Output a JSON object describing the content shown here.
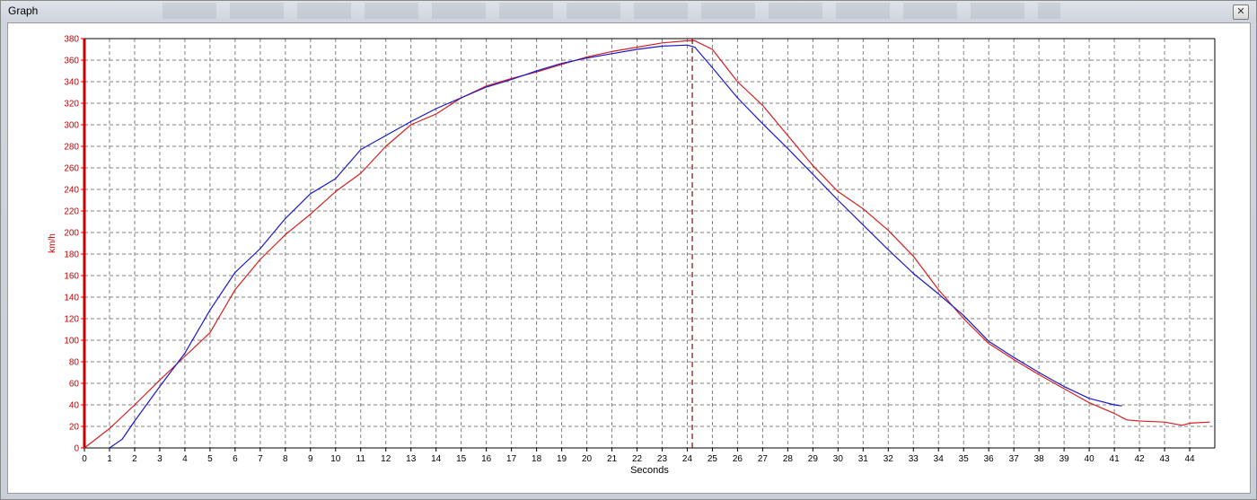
{
  "window": {
    "title": "Graph",
    "close_glyph": "✕",
    "close_icon": "close-icon"
  },
  "colors": {
    "axis": "#cc0000",
    "series_red": "#d42020",
    "series_blue": "#1a1acc",
    "marker": "#8b0000",
    "grid": "#808080"
  },
  "chart_data": {
    "type": "line",
    "xlabel": "Seconds",
    "ylabel": "km/h",
    "xlim": [
      0,
      45
    ],
    "ylim": [
      0,
      380
    ],
    "xticks": [
      0,
      1,
      2,
      3,
      4,
      5,
      6,
      7,
      8,
      9,
      10,
      11,
      12,
      13,
      14,
      15,
      16,
      17,
      18,
      19,
      20,
      21,
      22,
      23,
      24,
      25,
      26,
      27,
      28,
      29,
      30,
      31,
      32,
      33,
      34,
      35,
      36,
      37,
      38,
      39,
      40,
      41,
      42,
      43,
      44
    ],
    "yticks": [
      0,
      20,
      40,
      60,
      80,
      100,
      120,
      140,
      160,
      180,
      200,
      220,
      240,
      260,
      280,
      300,
      320,
      340,
      360,
      380
    ],
    "grid": true,
    "marker_x": 24.2,
    "series": [
      {
        "color": "red",
        "x": [
          0,
          1,
          2,
          3,
          4,
          5,
          6,
          7,
          8,
          9,
          10,
          11,
          12,
          13,
          14,
          15,
          16,
          17,
          18,
          19,
          20,
          21,
          22,
          23,
          24,
          24.3,
          25,
          26,
          27,
          28,
          29,
          30,
          31,
          32,
          33,
          34,
          35,
          36,
          37,
          38,
          39,
          40,
          41,
          41.5,
          42,
          43,
          43.7,
          44,
          44.8
        ],
        "y": [
          0,
          18,
          40,
          63,
          85,
          107,
          147,
          175,
          198,
          217,
          238,
          255,
          280,
          300,
          310,
          325,
          336,
          343,
          349,
          356,
          363,
          368,
          372,
          376,
          378,
          378,
          370,
          340,
          318,
          290,
          262,
          238,
          222,
          202,
          178,
          147,
          120,
          97,
          82,
          68,
          55,
          42,
          32,
          26,
          25,
          24,
          21,
          23,
          24
        ]
      },
      {
        "color": "blue",
        "x": [
          1,
          1.5,
          2,
          3,
          4,
          5,
          6,
          7,
          8,
          9,
          10,
          11,
          12,
          13,
          14,
          15,
          16,
          17,
          18,
          19,
          20,
          21,
          22,
          23,
          24,
          24.3,
          25,
          26,
          27,
          28,
          29,
          30,
          31,
          32,
          33,
          34,
          35,
          36,
          37,
          38,
          39,
          40,
          41,
          41.3
        ],
        "y": [
          0,
          8,
          25,
          57,
          88,
          128,
          163,
          185,
          213,
          236,
          250,
          277,
          290,
          303,
          315,
          325,
          335,
          342,
          350,
          357,
          362,
          366,
          370,
          373,
          374,
          372,
          353,
          325,
          301,
          278,
          254,
          230,
          207,
          184,
          162,
          143,
          123,
          99,
          84,
          70,
          57,
          46,
          40,
          39
        ]
      }
    ]
  }
}
